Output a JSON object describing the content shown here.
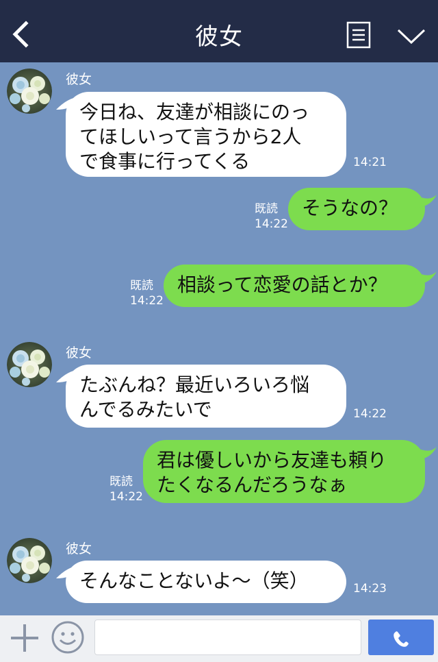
{
  "header": {
    "title": "彼女"
  },
  "messages": [
    {
      "side": "left",
      "sender": "彼女",
      "lines": [
        "今日ね、友達が相談にのっ",
        "てほしいって言うから2人",
        "で食事に行ってくる"
      ],
      "time": "14:21"
    },
    {
      "side": "right",
      "read": "既読",
      "lines": [
        "そうなの？"
      ],
      "time": "14:22"
    },
    {
      "side": "right",
      "read": "既読",
      "lines": [
        "相談って恋愛の話とか？"
      ],
      "time": "14:22"
    },
    {
      "side": "left",
      "sender": "彼女",
      "lines": [
        "たぶんね？最近いろいろ悩",
        "んでるみたいで"
      ],
      "time": "14:22"
    },
    {
      "side": "right",
      "read": "既読",
      "lines": [
        "君は優しいから友達も頼り",
        "たくなるんだろうなぁ"
      ],
      "time": "14:22"
    },
    {
      "side": "left",
      "sender": "彼女",
      "lines": [
        "そんなことないよ〜（笑）"
      ],
      "time": "14:23"
    }
  ],
  "footer": {
    "input_value": ""
  },
  "colors": {
    "header_bg": "#232c47",
    "chat_bg": "#7494c0",
    "bubble_in": "#ffffff",
    "bubble_out": "#7ddc4e",
    "call_button": "#4f7fe0"
  },
  "icons": {
    "back": "chevron-left-icon",
    "menu": "menu-list-icon",
    "collapse": "chevron-down-icon",
    "plus": "plus-icon",
    "sticker": "smile-icon",
    "call": "phone-icon",
    "avatar": "rose-avatar"
  }
}
